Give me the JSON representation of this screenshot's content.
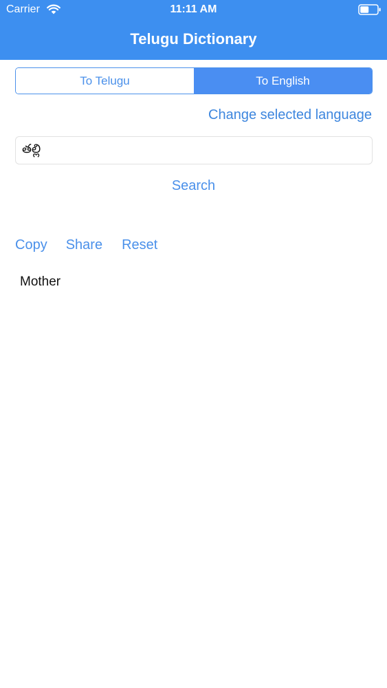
{
  "status_bar": {
    "carrier": "Carrier",
    "time": "11:11 AM",
    "wifi_icon": "wifi-icon",
    "battery_icon": "battery-icon"
  },
  "nav": {
    "title": "Telugu Dictionary"
  },
  "segmented": {
    "options": [
      "To Telugu",
      "To English"
    ],
    "selected": "To English"
  },
  "change_language_label": "Change selected language",
  "search": {
    "value": "తల్లి",
    "button_label": "Search"
  },
  "actions": {
    "copy": "Copy",
    "share": "Share",
    "reset": "Reset"
  },
  "result": {
    "text": "Mother"
  },
  "colors": {
    "header": "#3d8ff0",
    "accent": "#4a90ea",
    "segment_selected": "#4a8ef2"
  }
}
